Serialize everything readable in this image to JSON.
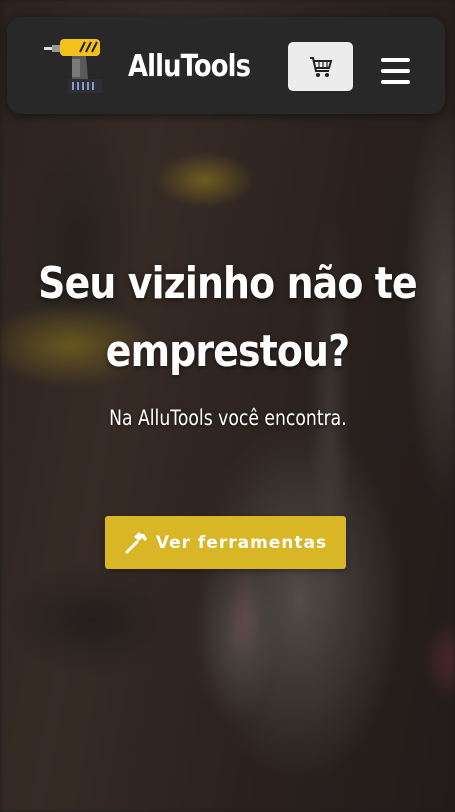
{
  "navbar": {
    "logo_icon": "drill-icon",
    "brand": "AlluTools",
    "cart_icon": "shopping-cart-icon",
    "menu_icon": "hamburger-menu-icon"
  },
  "hero": {
    "title_line1": "Seu vizinho não te",
    "title_line2": "emprestou?",
    "subtitle": "Na AlluTools você encontra.",
    "cta_icon": "hammer-icon",
    "cta_label": "Ver ferramentas"
  },
  "colors": {
    "navbar_bg": "#282828",
    "accent_yellow": "#d9b626",
    "cart_button_bg": "#ececec",
    "text": "#ffffff"
  }
}
